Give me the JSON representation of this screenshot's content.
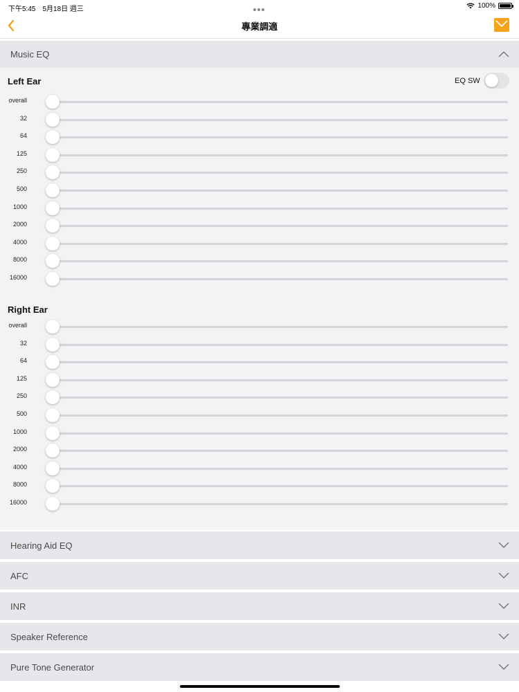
{
  "status_bar": {
    "time_date": "下午5:45　5月18日 週三",
    "battery_text": "100%"
  },
  "nav": {
    "title": "專業調適",
    "accent_color": "#f5a318"
  },
  "music_eq": {
    "label": "Music EQ",
    "eq_switch": {
      "label": "EQ SW",
      "on": false
    },
    "left_ear": {
      "title": "Left Ear",
      "bands": [
        {
          "label": "overall",
          "value": 0
        },
        {
          "label": "32",
          "value": 0
        },
        {
          "label": "64",
          "value": 0
        },
        {
          "label": "125",
          "value": 0
        },
        {
          "label": "250",
          "value": 0
        },
        {
          "label": "500",
          "value": 0
        },
        {
          "label": "1000",
          "value": 0
        },
        {
          "label": "2000",
          "value": 0
        },
        {
          "label": "4000",
          "value": 0
        },
        {
          "label": "8000",
          "value": 0
        },
        {
          "label": "16000",
          "value": 0
        }
      ]
    },
    "right_ear": {
      "title": "Right Ear",
      "bands": [
        {
          "label": "overall",
          "value": 0
        },
        {
          "label": "32",
          "value": 0
        },
        {
          "label": "64",
          "value": 0
        },
        {
          "label": "125",
          "value": 0
        },
        {
          "label": "250",
          "value": 0
        },
        {
          "label": "500",
          "value": 0
        },
        {
          "label": "1000",
          "value": 0
        },
        {
          "label": "2000",
          "value": 0
        },
        {
          "label": "4000",
          "value": 0
        },
        {
          "label": "8000",
          "value": 0
        },
        {
          "label": "16000",
          "value": 0
        }
      ]
    }
  },
  "collapsed_sections": [
    {
      "label": "Hearing Aid EQ"
    },
    {
      "label": "AFC"
    },
    {
      "label": "INR"
    },
    {
      "label": "Speaker Reference"
    },
    {
      "label": "Pure Tone Generator"
    }
  ]
}
